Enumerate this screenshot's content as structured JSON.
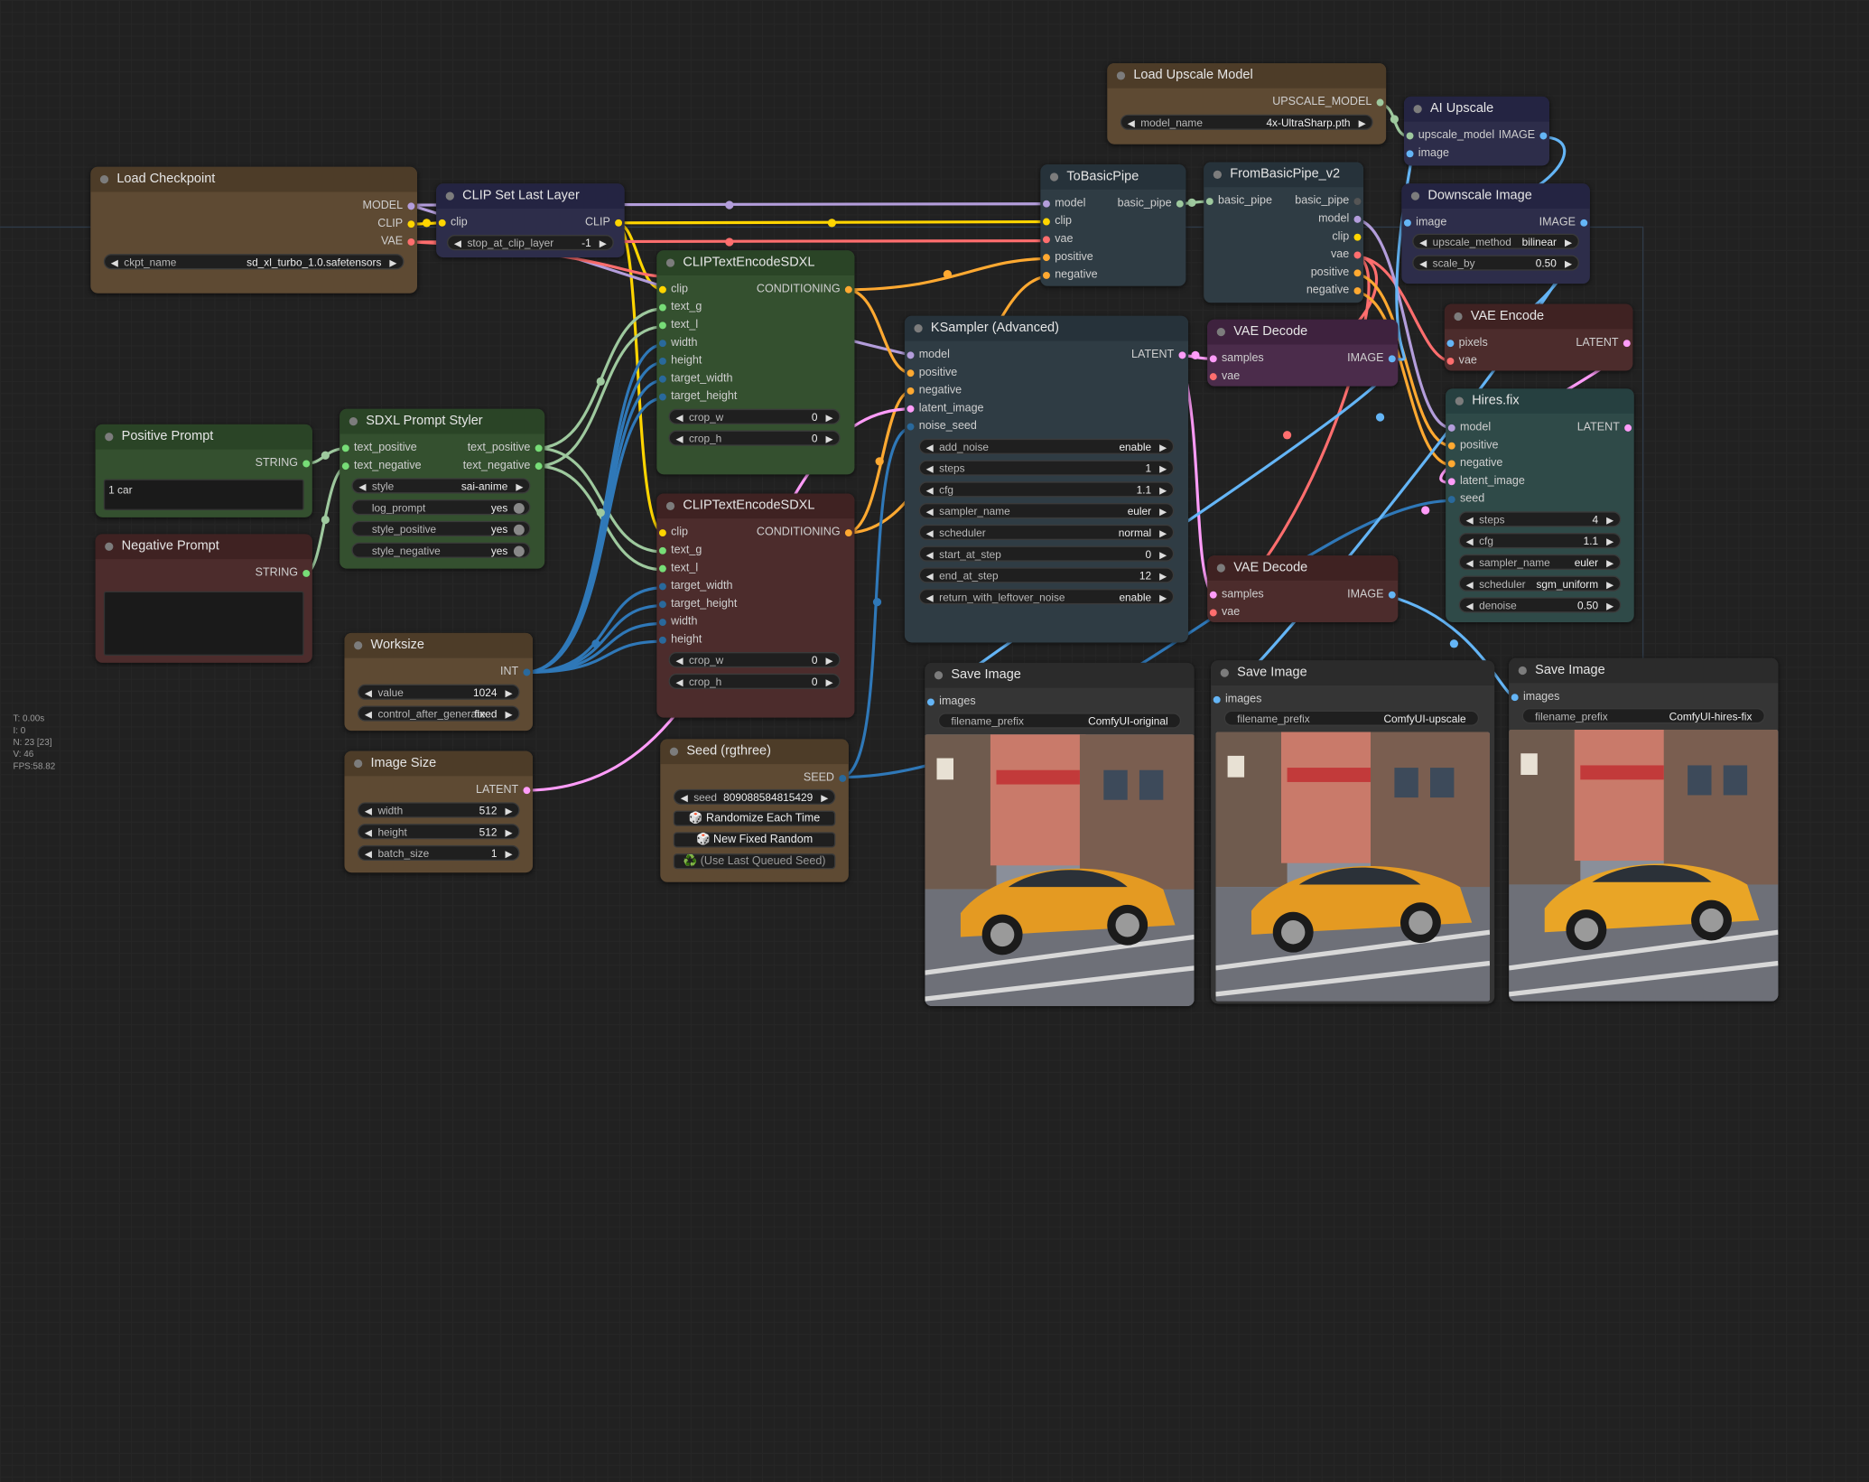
{
  "stats": {
    "t": "T: 0.00s",
    "i": "I: 0",
    "n": "N: 23 [23]",
    "v": "V: 46",
    "fps": "FPS:58.82"
  },
  "colors": {
    "model": "#b39ddb",
    "clip": "#ffd500",
    "vae": "#ff6e6e",
    "conditioning": "#ffa931",
    "latent": "#ff9cf9",
    "image": "#64b5f6",
    "int": "#29699c",
    "string": "#77dd77",
    "pipe": "#9ec99e"
  },
  "nodes": {
    "load_checkpoint": {
      "title": "Load Checkpoint",
      "out_model": "MODEL",
      "out_clip": "CLIP",
      "out_vae": "VAE",
      "ckpt_label": "ckpt_name",
      "ckpt_value": "sd_xl_turbo_1.0.safetensors"
    },
    "clip_set_last_layer": {
      "title": "CLIP Set Last Layer",
      "in_clip": "clip",
      "out_clip": "CLIP",
      "w_label": "stop_at_clip_layer",
      "w_value": "-1"
    },
    "positive_prompt": {
      "title": "Positive Prompt",
      "out": "STRING",
      "text": "1 car"
    },
    "negative_prompt": {
      "title": "Negative Prompt",
      "out": "STRING",
      "text": ""
    },
    "sdxl_styler": {
      "title": "SDXL Prompt Styler",
      "in_pos": "text_positive",
      "in_neg": "text_negative",
      "out_pos": "text_positive",
      "out_neg": "text_negative",
      "style_label": "style",
      "style_value": "sai-anime",
      "log_label": "log_prompt",
      "log_value": "yes",
      "sp_label": "style_positive",
      "sp_value": "yes",
      "sn_label": "style_negative",
      "sn_value": "yes"
    },
    "worksize": {
      "title": "Worksize",
      "out": "INT",
      "value_label": "value",
      "value": "1024",
      "ctrl_label": "control_after_generate",
      "ctrl_value": "fixed"
    },
    "image_size": {
      "title": "Image Size",
      "out": "LATENT",
      "w_label": "width",
      "w_value": "512",
      "h_label": "height",
      "h_value": "512",
      "b_label": "batch_size",
      "b_value": "1"
    },
    "clip_text_encode_pos": {
      "title": "CLIPTextEncodeSDXL",
      "in": [
        "clip",
        "text_g",
        "text_l",
        "width",
        "height",
        "target_width",
        "target_height"
      ],
      "out": "CONDITIONING",
      "cw_label": "crop_w",
      "cw_value": "0",
      "ch_label": "crop_h",
      "ch_value": "0"
    },
    "clip_text_encode_neg": {
      "title": "CLIPTextEncodeSDXL",
      "in": [
        "clip",
        "text_g",
        "text_l",
        "target_width",
        "target_height",
        "width",
        "height"
      ],
      "out": "CONDITIONING",
      "cw_label": "crop_w",
      "cw_value": "0",
      "ch_label": "crop_h",
      "ch_value": "0"
    },
    "seed": {
      "title": "Seed (rgthree)",
      "out": "SEED",
      "seed_label": "seed",
      "seed_value": "809088584815429",
      "btn1": "🎲 Randomize Each Time",
      "btn2": "🎲 New Fixed Random",
      "btn3": "♻️ (Use Last Queued Seed)"
    },
    "to_basic_pipe": {
      "title": "ToBasicPipe",
      "in": [
        "model",
        "clip",
        "vae",
        "positive",
        "negative"
      ],
      "out": "basic_pipe"
    },
    "from_basic_pipe": {
      "title": "FromBasicPipe_v2",
      "in": "basic_pipe",
      "out": [
        "basic_pipe",
        "model",
        "clip",
        "vae",
        "positive",
        "negative"
      ]
    },
    "ksampler": {
      "title": "KSampler (Advanced)",
      "in": [
        "model",
        "positive",
        "negative",
        "latent_image",
        "noise_seed"
      ],
      "out": "LATENT",
      "widgets": [
        [
          "add_noise",
          "enable"
        ],
        [
          "steps",
          "1"
        ],
        [
          "cfg",
          "1.1"
        ],
        [
          "sampler_name",
          "euler"
        ],
        [
          "scheduler",
          "normal"
        ],
        [
          "start_at_step",
          "0"
        ],
        [
          "end_at_step",
          "12"
        ],
        [
          "return_with_leftover_noise",
          "enable"
        ]
      ]
    },
    "vae_decode_1": {
      "title": "VAE Decode",
      "in": [
        "samples",
        "vae"
      ],
      "out": "IMAGE"
    },
    "vae_decode_2": {
      "title": "VAE Decode",
      "in": [
        "samples",
        "vae"
      ],
      "out": "IMAGE"
    },
    "load_upscale": {
      "title": "Load Upscale Model",
      "out": "UPSCALE_MODEL",
      "w_label": "model_name",
      "w_value": "4x-UltraSharp.pth"
    },
    "ai_upscale": {
      "title": "AI Upscale",
      "in": [
        "upscale_model",
        "image"
      ],
      "out": "IMAGE"
    },
    "downscale": {
      "title": "Downscale Image",
      "in": "image",
      "out": "IMAGE",
      "m_label": "upscale_method",
      "m_value": "bilinear",
      "s_label": "scale_by",
      "s_value": "0.50"
    },
    "vae_encode": {
      "title": "VAE Encode",
      "in": [
        "pixels",
        "vae"
      ],
      "out": "LATENT"
    },
    "hires_fix": {
      "title": "Hires.fix",
      "in": [
        "model",
        "positive",
        "negative",
        "latent_image",
        "seed"
      ],
      "out": "LATENT",
      "widgets": [
        [
          "steps",
          "4"
        ],
        [
          "cfg",
          "1.1"
        ],
        [
          "sampler_name",
          "euler"
        ],
        [
          "scheduler",
          "sgm_uniform"
        ],
        [
          "denoise",
          "0.50"
        ]
      ]
    },
    "save_1": {
      "title": "Save Image",
      "in": "images",
      "p_label": "filename_prefix",
      "p_value": "ComfyUI-original"
    },
    "save_2": {
      "title": "Save Image",
      "in": "images",
      "p_label": "filename_prefix",
      "p_value": "ComfyUI-upscale"
    },
    "save_3": {
      "title": "Save Image",
      "in": "images",
      "p_label": "filename_prefix",
      "p_value": "ComfyUI-hires-fix"
    }
  }
}
